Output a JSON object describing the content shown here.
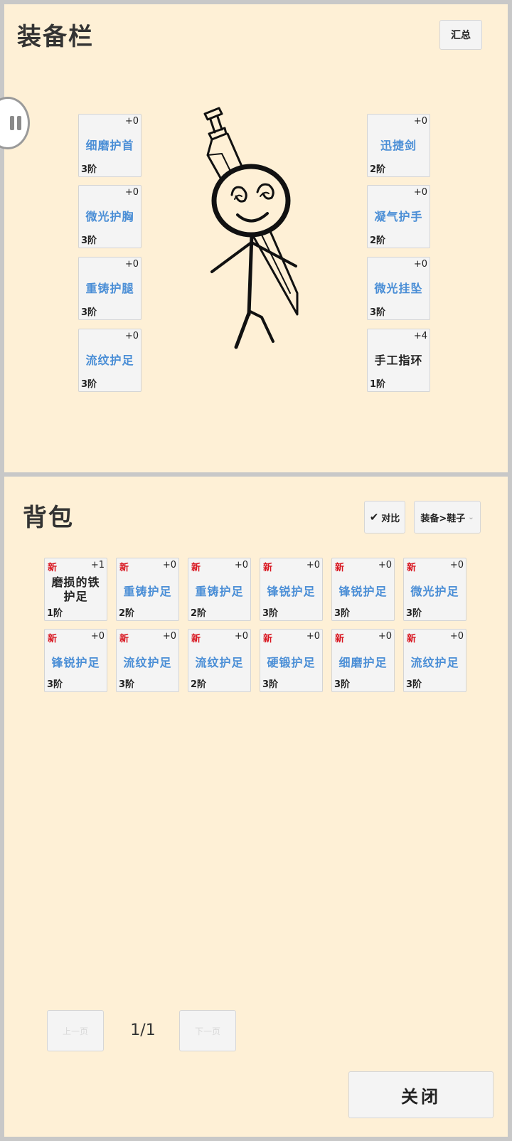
{
  "equipment_panel": {
    "title": "装备栏",
    "summary_button": "汇总",
    "left_slots": [
      {
        "level": "+0",
        "name": "细磨护首",
        "tier": "3阶"
      },
      {
        "level": "+0",
        "name": "微光护胸",
        "tier": "3阶"
      },
      {
        "level": "+0",
        "name": "重铸护腿",
        "tier": "3阶"
      },
      {
        "level": "+0",
        "name": "流纹护足",
        "tier": "3阶"
      }
    ],
    "right_slots": [
      {
        "level": "+0",
        "name": "迅捷剑",
        "tier": "2阶"
      },
      {
        "level": "+0",
        "name": "凝气护手",
        "tier": "2阶"
      },
      {
        "level": "+0",
        "name": "微光挂坠",
        "tier": "3阶"
      },
      {
        "level": "+4",
        "name": "手工指环",
        "tier": "1阶"
      }
    ]
  },
  "bag_panel": {
    "title": "背包",
    "compare_label": "对比",
    "filter_value": "装备>鞋子",
    "new_tag": "新",
    "items": [
      {
        "level": "+1",
        "name_line1": "磨损的铁",
        "name_line2": "护足",
        "tier": "1阶"
      },
      {
        "level": "+0",
        "name": "重铸护足",
        "tier": "2阶"
      },
      {
        "level": "+0",
        "name": "重铸护足",
        "tier": "2阶"
      },
      {
        "level": "+0",
        "name": "锋锐护足",
        "tier": "3阶"
      },
      {
        "level": "+0",
        "name": "锋锐护足",
        "tier": "3阶"
      },
      {
        "level": "+0",
        "name": "微光护足",
        "tier": "3阶"
      },
      {
        "level": "+0",
        "name": "锋锐护足",
        "tier": "3阶"
      },
      {
        "level": "+0",
        "name": "流纹护足",
        "tier": "3阶"
      },
      {
        "level": "+0",
        "name": "流纹护足",
        "tier": "2阶"
      },
      {
        "level": "+0",
        "name": "硬锻护足",
        "tier": "3阶"
      },
      {
        "level": "+0",
        "name": "细磨护足",
        "tier": "3阶"
      },
      {
        "level": "+0",
        "name": "流纹护足",
        "tier": "3阶"
      }
    ],
    "pagination": {
      "prev": "上一页",
      "page": "1/1",
      "next": "下一页"
    },
    "close_button": "关闭"
  },
  "colors": {
    "panel_bg": "#fef0d6",
    "item_name": "#4a8ed6",
    "new_tag": "#d8141e",
    "frame": "#c8c8c8"
  },
  "icons": {
    "float_button": "pause-icon",
    "compare": "check-icon",
    "filter": "chevron-down-icon"
  }
}
